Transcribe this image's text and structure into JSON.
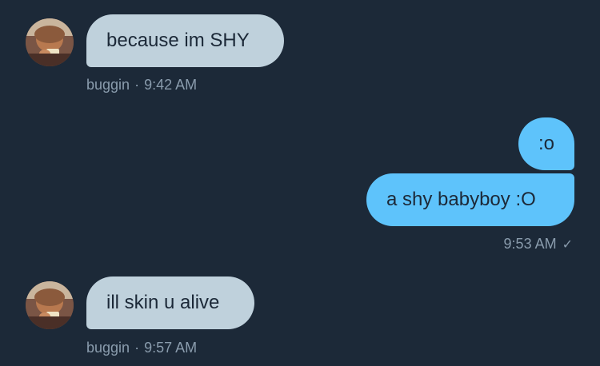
{
  "messages": [
    {
      "direction": "received",
      "text": "because im SHY",
      "sender": "buggin",
      "separator": "·",
      "time": "9:42 AM"
    },
    {
      "direction": "sent",
      "text": ":o"
    },
    {
      "direction": "sent",
      "text": "a shy babyboy :O",
      "time": "9:53 AM",
      "status_icon": "check-icon"
    },
    {
      "direction": "received",
      "text": "ill skin u alive",
      "sender": "buggin",
      "separator": "·",
      "time": "9:57 AM"
    }
  ],
  "colors": {
    "background": "#1c2938",
    "received_bubble": "#bfd1dc",
    "sent_bubble": "#5ec3fb",
    "meta_text": "#8a9cad"
  },
  "icons": {
    "check": "✓"
  }
}
